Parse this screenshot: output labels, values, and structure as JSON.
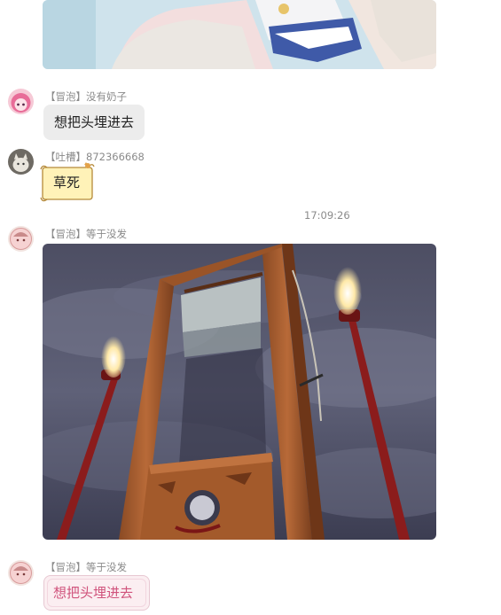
{
  "messages": [
    {
      "kind": "image",
      "image": "anime-illustration-partial"
    },
    {
      "kind": "text",
      "avatar": "pink-haired-anime-avatar",
      "title": "【冒泡】",
      "name": "没有奶子",
      "text": "想把头埋进去"
    },
    {
      "kind": "text",
      "avatar": "cat-avatar",
      "title": "【吐槽】",
      "name": "872366668",
      "text": "草死",
      "bubble_style": "scroll-bubble"
    },
    {
      "kind": "timestamp",
      "text": "17:09:26"
    },
    {
      "kind": "image",
      "avatar": "round-anime-avatar",
      "title": "【冒泡】",
      "name": "等于没发",
      "image": "guillotine-with-torches-photo"
    },
    {
      "kind": "text",
      "avatar": "round-anime-avatar",
      "title": "【冒泡】",
      "name": "等于没发",
      "text": "想把头埋进去",
      "bubble_style": "pink-frame-bubble"
    }
  ],
  "colors": {
    "name_text": "#8a8a8a",
    "bubble_bg": "#ececec",
    "scroll_bubble_bg": "#fff2b8",
    "pink_text": "#d0537c"
  }
}
